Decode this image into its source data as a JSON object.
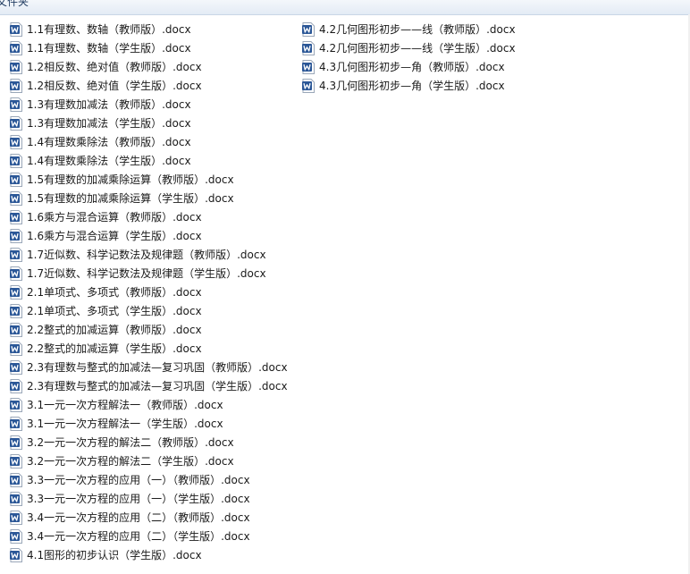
{
  "header": {
    "title": "文件夹"
  },
  "icon": {
    "name": "word-doc-icon",
    "color": "#2b5797",
    "accent": "#ffffff"
  },
  "files_col1": [
    "1.1有理数、数轴（教师版）.docx",
    "1.1有理数、数轴（学生版）.docx",
    "1.2相反数、绝对值（教师版）.docx",
    "1.2相反数、绝对值（学生版）.docx",
    "1.3有理数加减法（教师版）.docx",
    "1.3有理数加减法（学生版）.docx",
    "1.4有理数乘除法（教师版）.docx",
    "1.4有理数乘除法（学生版）.docx",
    "1.5有理数的加减乘除运算（教师版）.docx",
    "1.5有理数的加减乘除运算（学生版）.docx",
    "1.6乘方与混合运算（教师版）.docx",
    "1.6乘方与混合运算（学生版）.docx",
    "1.7近似数、科学记数法及规律题（教师版）.docx",
    "1.7近似数、科学记数法及规律题（学生版）.docx",
    "2.1单项式、多项式（教师版）.docx",
    "2.1单项式、多项式（学生版）.docx",
    "2.2整式的加减运算（教师版）.docx",
    "2.2整式的加减运算（学生版）.docx",
    "2.3有理数与整式的加减法—复习巩固（教师版）.docx",
    "2.3有理数与整式的加减法—复习巩固（学生版）.docx",
    "3.1一元一次方程解法一（教师版）.docx",
    "3.1一元一次方程解法一（学生版）.docx",
    "3.2一元一次方程的解法二（教师版）.docx",
    "3.2一元一次方程的解法二（学生版）.docx",
    "3.3一元一次方程的应用（一）（教师版）.docx",
    "3.3一元一次方程的应用（一）（学生版）.docx",
    "3.4一元一次方程的应用（二）（教师版）.docx",
    "3.4一元一次方程的应用（二）（学生版）.docx",
    "4.1图形的初步认识（学生版）.docx"
  ],
  "files_col2": [
    "4.2几何图形初步——线（教师版）.docx",
    "4.2几何图形初步——线（学生版）.docx",
    "4.3几何图形初步—角（教师版）.docx",
    "4.3几何图形初步—角（学生版）.docx"
  ]
}
